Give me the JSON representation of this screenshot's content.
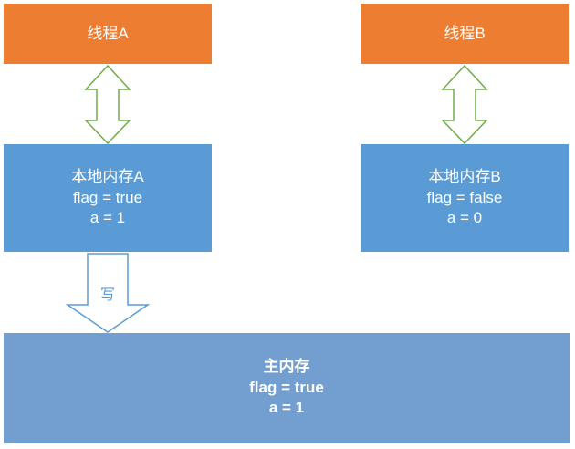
{
  "thread_a": {
    "label": "线程A"
  },
  "thread_b": {
    "label": "线程B"
  },
  "local_memory_a": {
    "title": "本地内存A",
    "flag": "flag = true",
    "a": "a = 1"
  },
  "local_memory_b": {
    "title": "本地内存B",
    "flag": "flag = false",
    "a": "a = 0"
  },
  "main_memory": {
    "title": "主内存",
    "flag": "flag = true",
    "a": "a = 1"
  },
  "write_arrow": {
    "label": "写"
  },
  "colors": {
    "thread_box": "#ed7d31",
    "local_memory_box": "#5b9bd5",
    "main_memory_box": "#729fcf",
    "bidirectional_arrow": "#70ad47",
    "write_arrow_outline": "#5b9bd5"
  }
}
